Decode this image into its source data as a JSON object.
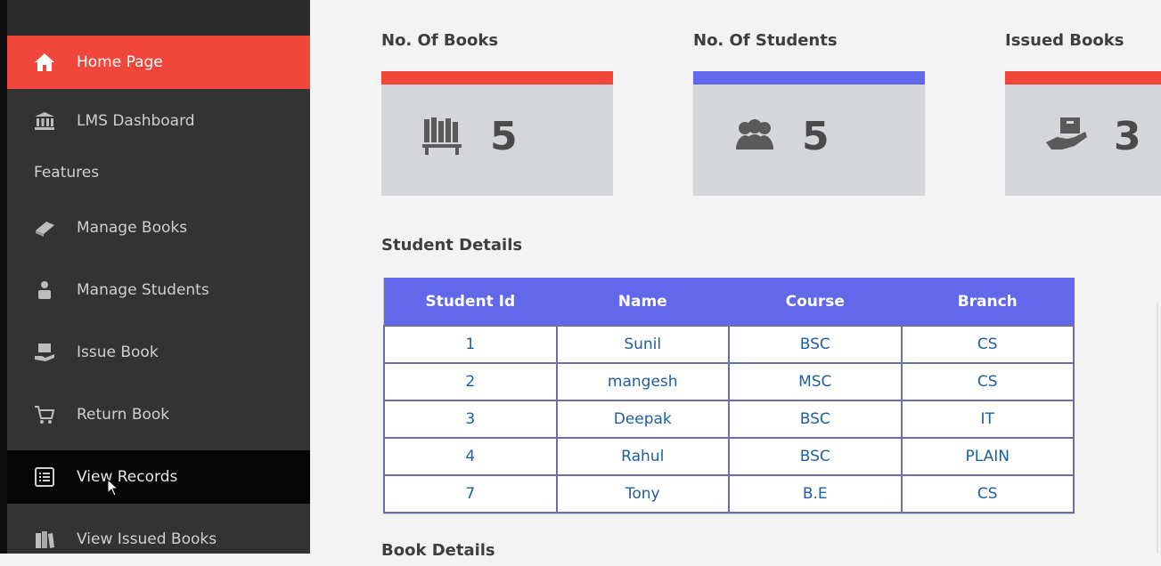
{
  "sidebar": {
    "items": [
      {
        "label": "Home Page",
        "icon": "home-icon"
      },
      {
        "label": "LMS Dashboard",
        "icon": "bank-icon"
      },
      {
        "label": "Manage Books",
        "icon": "book-icon"
      },
      {
        "label": "Manage Students",
        "icon": "user-icon"
      },
      {
        "label": "Issue Book",
        "icon": "issue-book-icon"
      },
      {
        "label": "Return Book",
        "icon": "cart-icon"
      },
      {
        "label": "View Records",
        "icon": "list-icon"
      },
      {
        "label": "View Issued Books",
        "icon": "books-icon"
      }
    ],
    "section_label": "Features",
    "active_color": "#f0473a"
  },
  "cards": [
    {
      "title": "No. Of Books",
      "value": "5",
      "accent": "#f0473a",
      "icon": "bookshelf-icon"
    },
    {
      "title": "No. Of Students",
      "value": "5",
      "accent": "#6169ea",
      "icon": "users-icon"
    },
    {
      "title": "Issued Books",
      "value": "3",
      "accent": "#f0473a",
      "icon": "hand-box-icon"
    }
  ],
  "student_details": {
    "title": "Student Details",
    "headers": [
      "Student Id",
      "Name",
      "Course",
      "Branch"
    ],
    "rows": [
      [
        "1",
        "Sunil",
        "BSC",
        "CS"
      ],
      [
        "2",
        "mangesh",
        "MSC",
        "CS"
      ],
      [
        "3",
        "Deepak",
        "BSC",
        "IT"
      ],
      [
        "4",
        "Rahul",
        "BSC",
        "PLAIN"
      ],
      [
        "7",
        "Tony",
        "B.E",
        "CS"
      ]
    ]
  },
  "book_details": {
    "title": "Book Details"
  }
}
